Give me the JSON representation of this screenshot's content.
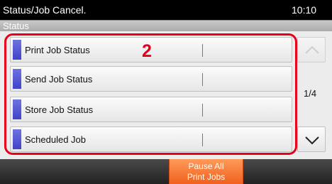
{
  "header": {
    "title": "Status/Job Cancel.",
    "time": "10:10"
  },
  "tab": {
    "label": "Status"
  },
  "annotation": {
    "callout": "2"
  },
  "list": {
    "items": [
      {
        "label": "Print Job Status"
      },
      {
        "label": "Send Job Status"
      },
      {
        "label": "Store Job Status"
      },
      {
        "label": "Scheduled Job"
      }
    ]
  },
  "pagination": {
    "indicator": "1/4"
  },
  "footer": {
    "pause_line1": "Pause All",
    "pause_line2": "Print Jobs"
  },
  "colors": {
    "accent_blue": "#3f43c8",
    "highlight_red": "#e8001a",
    "pause_orange": "#f0601c"
  }
}
